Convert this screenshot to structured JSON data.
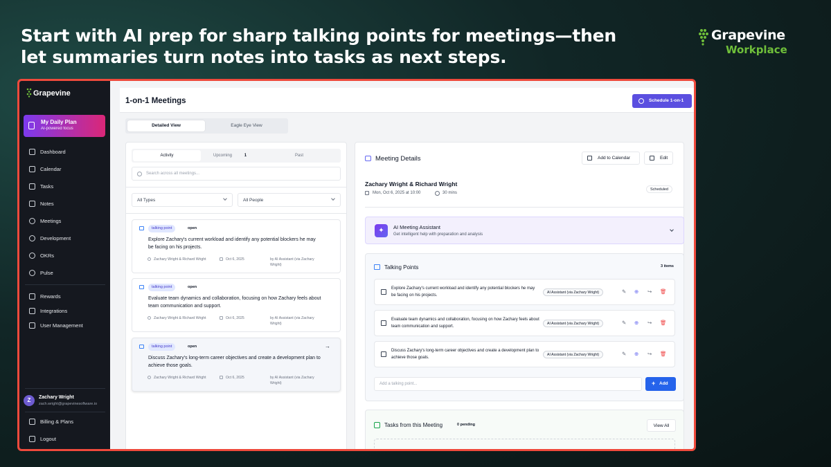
{
  "headline": {
    "line1": "Start with AI prep for sharp talking points for meetings—then",
    "line2": "let summaries turn notes into tasks as next steps."
  },
  "brand": {
    "name": "Grapevine",
    "sub": "Workplace"
  },
  "colors": {
    "accent": "#5b4fe0",
    "frame": "#ef4a3c",
    "sidebar": "#15181f",
    "primary_blue": "#2563eb",
    "brand_green": "#6fbf3a"
  },
  "sidebar": {
    "logo": "Grapevine",
    "daily_plan": {
      "title": "My Daily Plan",
      "subtitle": "AI-powered focus"
    },
    "items": [
      {
        "label": "Dashboard",
        "icon": "home-icon"
      },
      {
        "label": "Calendar",
        "icon": "calendar-icon"
      },
      {
        "label": "Tasks",
        "icon": "check-square-icon"
      },
      {
        "label": "Notes",
        "icon": "file-icon"
      },
      {
        "label": "Meetings",
        "icon": "users-icon"
      },
      {
        "label": "Development",
        "icon": "message-icon"
      },
      {
        "label": "OKRs",
        "icon": "target-icon"
      },
      {
        "label": "Pulse",
        "icon": "heart-icon"
      }
    ],
    "items2": [
      {
        "label": "Rewards",
        "icon": "trophy-icon"
      },
      {
        "label": "Integrations",
        "icon": "plug-icon"
      },
      {
        "label": "User Management",
        "icon": "shield-icon"
      }
    ],
    "user": {
      "initial": "Z",
      "name": "Zachary Wright",
      "email": "zach.wright@grapevinesoftware.io"
    },
    "bottom": [
      {
        "label": "Billing & Plans",
        "icon": "card-icon"
      },
      {
        "label": "Logout",
        "icon": "logout-icon"
      }
    ]
  },
  "header": {
    "title": "1-on-1 Meetings",
    "schedule_label": "Schedule 1-on-1"
  },
  "view_tabs": [
    {
      "label": "Detailed View"
    },
    {
      "label": "Eagle Eye View"
    }
  ],
  "list": {
    "tabs": [
      {
        "label": "Activity"
      },
      {
        "label": "Upcoming",
        "count": "1"
      },
      {
        "label": "Past"
      }
    ],
    "search_placeholder": "Search across all meetings...",
    "filter_type": "All Types",
    "filter_people": "All People",
    "cards": [
      {
        "tag": "talking point",
        "status": "open",
        "text": "Explore Zachary's current workload and identify any potential blockers he may be facing on his projects.",
        "people": "Zachary Wright & Richard Wright",
        "date": "Oct 6, 2025",
        "by": "by AI Assistant (via Zachary Wright)"
      },
      {
        "tag": "talking point",
        "status": "open",
        "text": "Evaluate team dynamics and collaboration, focusing on how Zachary feels about team communication and support.",
        "people": "Zachary Wright & Richard Wright",
        "date": "Oct 6, 2025",
        "by": "by AI Assistant (via Zachary Wright)"
      },
      {
        "tag": "talking point",
        "status": "open",
        "text": "Discuss Zachary's long-term career objectives and create a development plan to achieve those goals.",
        "people": "Zachary Wright & Richard Wright",
        "date": "Oct 6, 2025",
        "by": "by AI Assistant (via Zachary Wright)"
      }
    ]
  },
  "details": {
    "title": "Meeting Details",
    "add_calendar": "Add to Calendar",
    "edit": "Edit",
    "meeting_name": "Zachary Wright & Richard Wright",
    "meeting_date": "Mon, Oct 6, 2025 at 10:00",
    "duration": "30 mins",
    "status": "Scheduled",
    "ai": {
      "title": "AI Meeting Assistant",
      "subtitle": "Get intelligent help with preparation and analysis"
    },
    "talking_points": {
      "title": "Talking Points",
      "count": "3 items",
      "items": [
        {
          "text": "Explore Zachary's current workload and identify any potential blockers he may be facing on his projects.",
          "author": "AI Assistant (via Zachary Wright)"
        },
        {
          "text": "Evaluate team dynamics and collaboration, focusing on how Zachary feels about team communication and support.",
          "author": "AI Assistant (via Zachary Wright)"
        },
        {
          "text": "Discuss Zachary's long-term career objectives and create a development plan to achieve those goals.",
          "author": "AI Assistant (via Zachary Wright)"
        }
      ],
      "add_placeholder": "Add a talking point...",
      "add_label": "Add"
    },
    "tasks": {
      "title": "Tasks from this Meeting",
      "pending": "0 pending",
      "view_all": "View All"
    }
  }
}
